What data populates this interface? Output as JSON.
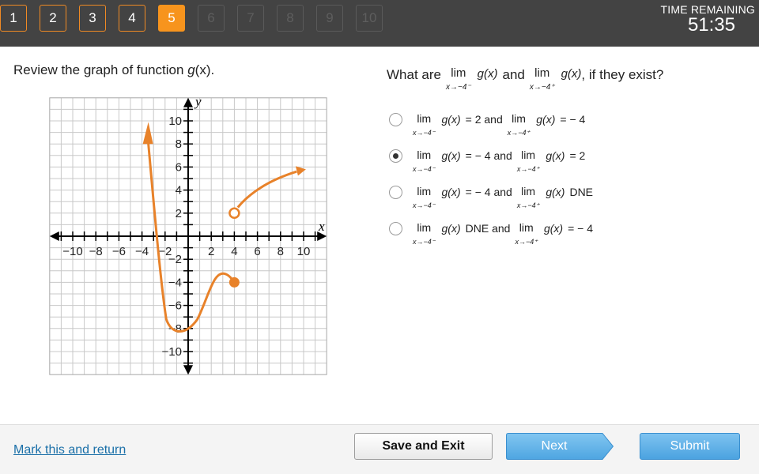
{
  "header": {
    "questions": [
      {
        "label": "1",
        "state": "done"
      },
      {
        "label": "2",
        "state": "done"
      },
      {
        "label": "3",
        "state": "done"
      },
      {
        "label": "4",
        "state": "done"
      },
      {
        "label": "5",
        "state": "current"
      },
      {
        "label": "6",
        "state": "todo"
      },
      {
        "label": "7",
        "state": "todo"
      },
      {
        "label": "8",
        "state": "todo"
      },
      {
        "label": "9",
        "state": "todo"
      },
      {
        "label": "10",
        "state": "todo"
      }
    ],
    "timer_label": "TIME REMAINING",
    "timer_value": "51:35"
  },
  "prompt": {
    "text_before": "Review the graph of function ",
    "function_name": "g",
    "text_after": "(x)."
  },
  "question": {
    "prefix": "What are",
    "lim_word": "lim",
    "left_sub": "x→−4⁻",
    "right_sub": "x→−4⁺",
    "func": "g(x)",
    "conj": "and",
    "suffix": ", if they exist?"
  },
  "options": [
    {
      "left_sub": "x→−4⁻",
      "left_val": "= 2 and",
      "right_sub": "x→−4⁺",
      "right_val": "= − 4",
      "selected": false
    },
    {
      "left_sub": "x→−4⁻",
      "left_val": "= − 4 and",
      "right_sub": "x→−4⁺",
      "right_val": "= 2",
      "selected": true
    },
    {
      "left_sub": "x→−4⁻",
      "left_val": "= − 4 and",
      "right_sub": "x→−4⁺",
      "right_val": "DNE",
      "selected": false
    },
    {
      "left_sub": "x→−4⁻",
      "left_val": "DNE and",
      "right_sub": "x→−4⁺",
      "right_val": "= − 4",
      "selected": false
    }
  ],
  "graph": {
    "x_axis_label": "x",
    "y_axis_label": "y",
    "x_ticks": [
      "−10",
      "−8",
      "−6",
      "−4",
      "−2",
      "2",
      "4",
      "6",
      "8",
      "10"
    ],
    "y_ticks": [
      "10",
      "8",
      "6",
      "4",
      "2",
      "−2",
      "−4",
      "−6",
      "−8",
      "−10"
    ],
    "curve_color": "#e8822a",
    "axis_color": "#000000",
    "grid_color": "#c8c8c8"
  },
  "footer": {
    "mark_label": "Mark this and return",
    "save_label": "Save and Exit",
    "next_label": "Next",
    "submit_label": "Submit"
  }
}
